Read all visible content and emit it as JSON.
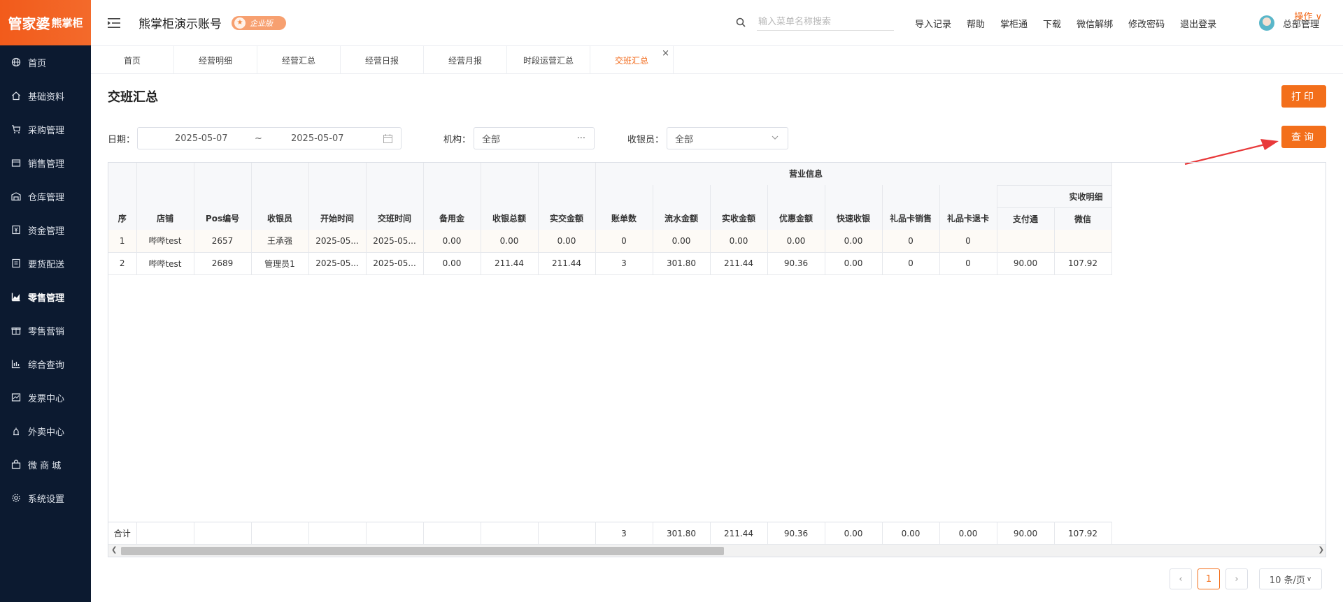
{
  "brand": {
    "logo_main": "管家婆",
    "logo_sub": "熊掌柜"
  },
  "sidebar": {
    "items": [
      {
        "label": "首页",
        "icon": "globe-icon"
      },
      {
        "label": "基础资料",
        "icon": "home-icon"
      },
      {
        "label": "采购管理",
        "icon": "cart-icon"
      },
      {
        "label": "销售管理",
        "icon": "sales-icon"
      },
      {
        "label": "仓库管理",
        "icon": "warehouse-icon"
      },
      {
        "label": "资金管理",
        "icon": "money-icon"
      },
      {
        "label": "要货配送",
        "icon": "delivery-icon"
      },
      {
        "label": "零售管理",
        "icon": "chart-icon",
        "active": true
      },
      {
        "label": "零售营销",
        "icon": "gift-icon"
      },
      {
        "label": "综合查询",
        "icon": "bar-chart-icon"
      },
      {
        "label": "发票中心",
        "icon": "invoice-icon"
      },
      {
        "label": "外卖中心",
        "icon": "takeout-icon"
      },
      {
        "label": "微 商 城",
        "icon": "shop-icon"
      },
      {
        "label": "系统设置",
        "icon": "gear-icon"
      }
    ]
  },
  "header": {
    "account_name": "熊掌柜演示账号",
    "edition_badge": "企业版",
    "search_placeholder": "输入菜单名称搜索",
    "links": [
      "导入记录",
      "帮助",
      "掌柜通",
      "下载",
      "微信解绑",
      "修改密码",
      "退出登录"
    ],
    "user_name": "总部管理"
  },
  "tabs": {
    "items": [
      "首页",
      "经营明细",
      "经营汇总",
      "经营日报",
      "经营月报",
      "时段运营汇总",
      "交班汇总"
    ],
    "active_index": 6,
    "operations_label": "操作"
  },
  "page": {
    "title": "交班汇总",
    "print_label": "打印",
    "query_label": "查询"
  },
  "filters": {
    "date_label": "日期：",
    "date_start": "2025-05-07",
    "date_sep": "~",
    "date_end": "2025-05-07",
    "org_label": "机构：",
    "org_value": "全部",
    "cashier_label": "收银员：",
    "cashier_value": "全部"
  },
  "table": {
    "group_headers": {
      "business_info": "营业信息",
      "actual_detail": "实收明细"
    },
    "columns": [
      "序",
      "店铺",
      "Pos编号",
      "收银员",
      "开始时间",
      "交班时间",
      "备用金",
      "收银总额",
      "实交金额",
      "账单数",
      "流水金额",
      "实收金额",
      "优惠金额",
      "快速收银",
      "礼品卡销售",
      "礼品卡退卡",
      "支付通",
      "微信"
    ],
    "rows": [
      [
        "1",
        "哔哔test",
        "2657",
        "王承强",
        "2025-05...",
        "2025-05...",
        "0.00",
        "0.00",
        "0.00",
        "0",
        "0.00",
        "0.00",
        "0.00",
        "0.00",
        "0",
        "0",
        "",
        ""
      ],
      [
        "2",
        "哔哔test",
        "2689",
        "管理员1",
        "2025-05...",
        "2025-05...",
        "0.00",
        "211.44",
        "211.44",
        "3",
        "301.80",
        "211.44",
        "90.36",
        "0.00",
        "0",
        "0",
        "90.00",
        "107.92"
      ]
    ],
    "footer": [
      "合计",
      "",
      "",
      "",
      "",
      "",
      "",
      "",
      "",
      "3",
      "301.80",
      "211.44",
      "90.36",
      "0.00",
      "0.00",
      "0.00",
      "90.00",
      "107.92"
    ]
  },
  "pagination": {
    "current_page": "1",
    "page_size": "10 条/页"
  },
  "colors": {
    "accent": "#f36f1b",
    "sidebar_bg": "#0c1a30",
    "annotation_arrow": "#e8393a"
  }
}
